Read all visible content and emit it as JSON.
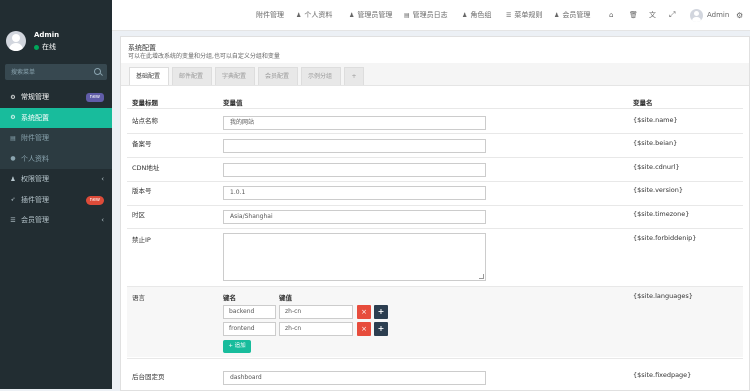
{
  "user": {
    "name": "Admin",
    "status": "在线"
  },
  "sidebar_search": {
    "placeholder": "搜索菜单"
  },
  "menu": {
    "general": {
      "label": "常规管理",
      "badge": "new"
    },
    "system_config": {
      "label": "系统配置"
    },
    "attachment": {
      "label": "附件管理"
    },
    "profile": {
      "label": "个人资料"
    },
    "auth": {
      "label": "权限管理"
    },
    "plugins": {
      "label": "插件管理",
      "badge": "new"
    },
    "members": {
      "label": "会员管理"
    }
  },
  "topnav": {
    "attachment": "附件管理",
    "profile": "个人资料",
    "admin_mgmt": "管理员管理",
    "admin_log": "管理员日志",
    "role_group": "角色组",
    "menu_rules": "菜单规则",
    "member_mgmt": "会员管理",
    "user": "Admin"
  },
  "panel": {
    "title": "系统配置",
    "subtitle": "可以在此增改系统的变量和分组,也可以自定义分组和变量"
  },
  "tabs": [
    "基础配置",
    "邮件配置",
    "字典配置",
    "会员配置",
    "示例分组",
    "+"
  ],
  "table": {
    "col_title": "变量标题",
    "col_value": "变量值",
    "col_name": "变量名"
  },
  "rows": {
    "name": {
      "label": "站点名称",
      "value": "我的网站",
      "var": "{$site.name}"
    },
    "beian": {
      "label": "备案号",
      "value": "",
      "var": "{$site.beian}"
    },
    "cdnurl": {
      "label": "CDN地址",
      "value": "",
      "var": "{$site.cdnurl}"
    },
    "version": {
      "label": "版本号",
      "value": "1.0.1",
      "var": "{$site.version}"
    },
    "timezone": {
      "label": "时区",
      "value": "Asia/Shanghai",
      "var": "{$site.timezone}"
    },
    "forbiddenip": {
      "label": "禁止IP",
      "value": "",
      "var": "{$site.forbiddenip}"
    },
    "languages": {
      "label": "语言",
      "var": "{$site.languages}",
      "key_header": "键名",
      "value_header": "键值",
      "items": [
        {
          "key": "backend",
          "value": "zh-cn"
        },
        {
          "key": "frontend",
          "value": "zh-cn"
        }
      ],
      "add_label": "追加"
    },
    "fixedpage": {
      "label": "后台固定页",
      "value": "dashboard",
      "var": "{$site.fixedpage}"
    }
  },
  "icons": {
    "delete": "×",
    "move": "+",
    "plus": "+"
  }
}
